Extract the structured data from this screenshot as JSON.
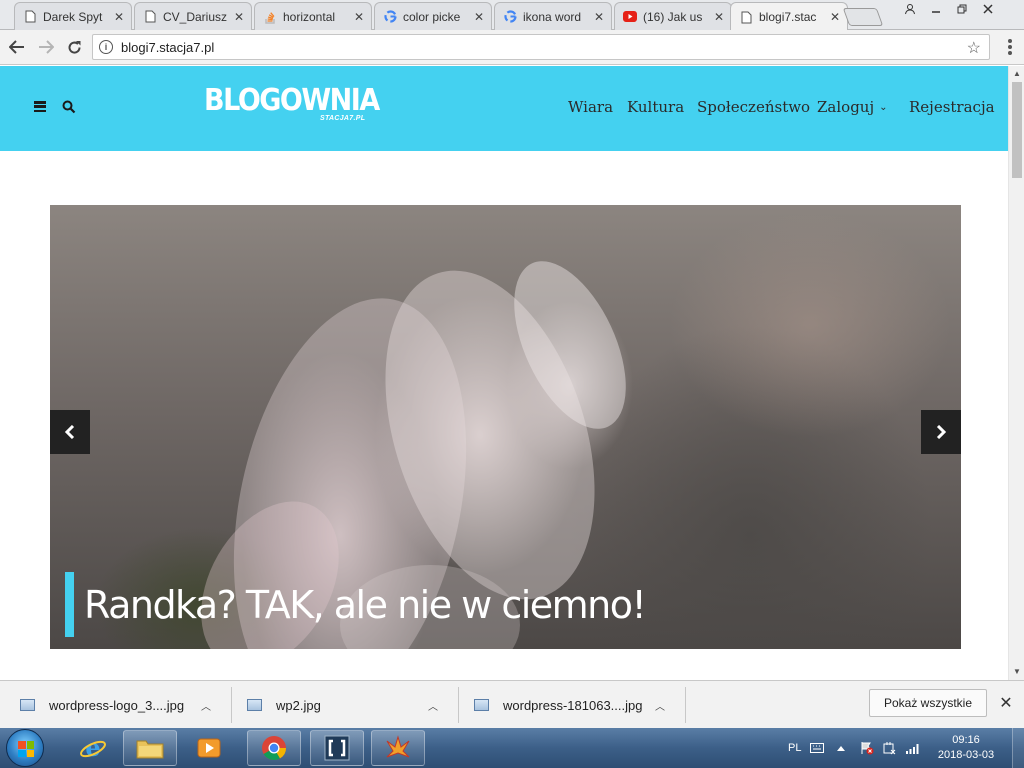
{
  "browser": {
    "tabs": [
      {
        "title": "Darek Spyt",
        "icon": "page-icon"
      },
      {
        "title": "CV_Dariusz",
        "icon": "page-icon"
      },
      {
        "title": "horizontal",
        "icon": "stackoverflow-icon"
      },
      {
        "title": "color picke",
        "icon": "google-icon"
      },
      {
        "title": "ikona word",
        "icon": "google-icon"
      },
      {
        "title": "(16) Jak us",
        "icon": "youtube-icon"
      },
      {
        "title": "blogi7.stac",
        "icon": "page-icon",
        "active": true
      }
    ],
    "url": "blogi7.stacja7.pl"
  },
  "site": {
    "logo_main": "BLOGOWNIA",
    "logo_sub": "STACJA7.PL",
    "header_color": "#44d1f0",
    "nav": [
      {
        "label": "Wiara"
      },
      {
        "label": "Kultura"
      },
      {
        "label": "Społeczeństwo"
      },
      {
        "label": "Zaloguj",
        "has_dropdown": true
      },
      {
        "label": "Rejestracja"
      }
    ]
  },
  "slider": {
    "title": "Randka? TAK, ale nie w ciemno!",
    "accent": "#44d1f0"
  },
  "downloads": {
    "items": [
      {
        "name": "wordpress-logo_3....jpg"
      },
      {
        "name": "wp2.jpg"
      },
      {
        "name": "wordpress-181063....jpg"
      }
    ],
    "show_all_label": "Pokaż wszystkie"
  },
  "taskbar": {
    "pinned_apps": [
      "internet-explorer-icon",
      "file-explorer-icon",
      "media-player-icon",
      "chrome-icon",
      "brackets-icon",
      "inkscape-icon"
    ],
    "language": "PL",
    "time": "09:16",
    "date": "2018-03-03"
  }
}
